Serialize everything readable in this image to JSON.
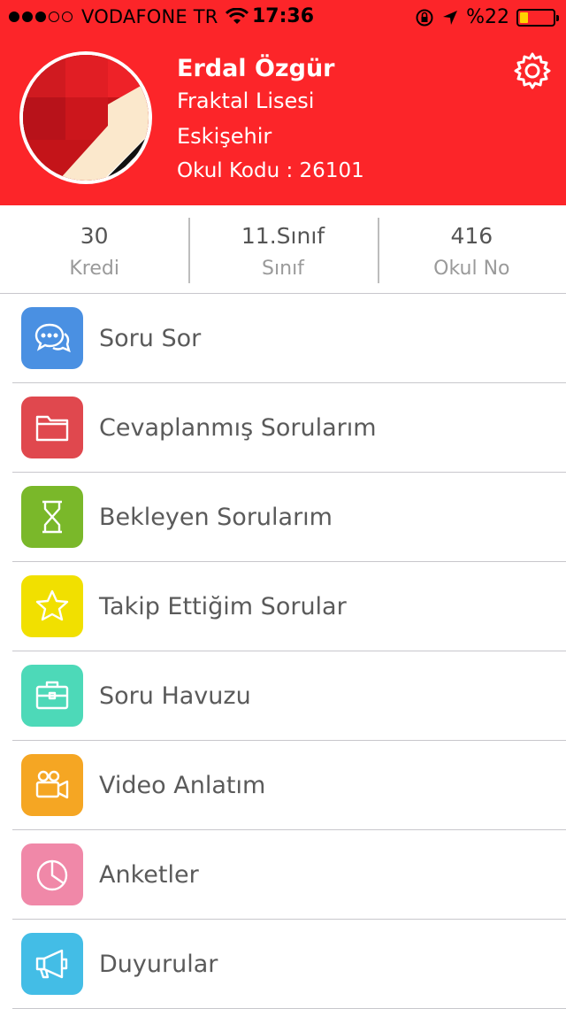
{
  "status_bar": {
    "carrier": "VODAFONE TR",
    "time": "17:36",
    "battery": "%22",
    "battery_level_percent": 22
  },
  "profile": {
    "name": "Erdal Özgür",
    "school": "Fraktal Lisesi",
    "city": "Eskişehir",
    "school_code": "Okul Kodu : 26101"
  },
  "stats": [
    {
      "value": "30",
      "label": "Kredi"
    },
    {
      "value": "11.Sınıf",
      "label": "Sınıf"
    },
    {
      "value": "416",
      "label": "Okul No"
    }
  ],
  "menu": [
    {
      "label": "Soru Sor",
      "icon": "chat-bubbles-icon",
      "color": "#4a90e2"
    },
    {
      "label": "Cevaplanmış Sorularım",
      "icon": "folder-icon",
      "color": "#e0484e"
    },
    {
      "label": "Bekleyen Sorularım",
      "icon": "hourglass-icon",
      "color": "#7ab82a"
    },
    {
      "label": "Takip Ettiğim Sorular",
      "icon": "star-icon",
      "color": "#f1e000"
    },
    {
      "label": "Soru Havuzu",
      "icon": "briefcase-icon",
      "color": "#4dd9b8"
    },
    {
      "label": "Video Anlatım",
      "icon": "video-camera-icon",
      "color": "#f5a623"
    },
    {
      "label": "Anketler",
      "icon": "pie-chart-icon",
      "color": "#f088a8"
    },
    {
      "label": "Duyurular",
      "icon": "megaphone-icon",
      "color": "#43bde6"
    }
  ],
  "colors": {
    "header": "#fc2529",
    "text": "#5a5a5a"
  }
}
